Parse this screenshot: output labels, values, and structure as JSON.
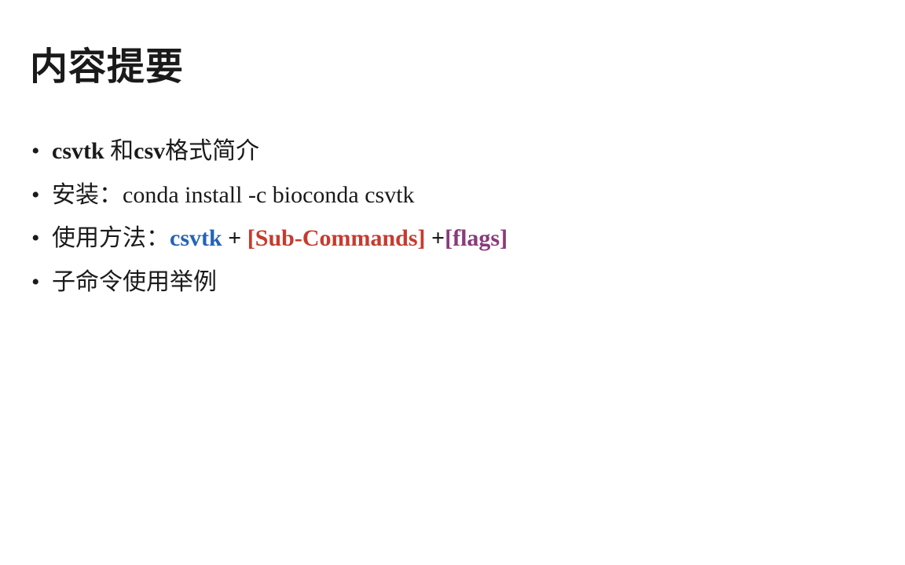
{
  "title": "内容提要",
  "bullets": {
    "b1_bold1": "csvtk ",
    "b1_txt1": "和",
    "b1_bold2": "csv",
    "b1_txt2": "格式简介",
    "b2_label": "安装：",
    "b2_cmd": "conda install -c bioconda csvtk",
    "b3_label": "使用方法：",
    "b3_csvtk": "csvtk",
    "b3_plus1": " + ",
    "b3_sub": "[Sub-Commands]",
    "b3_plus2": " +",
    "b3_flags": "[flags]",
    "b4": "子命令使用举例"
  }
}
